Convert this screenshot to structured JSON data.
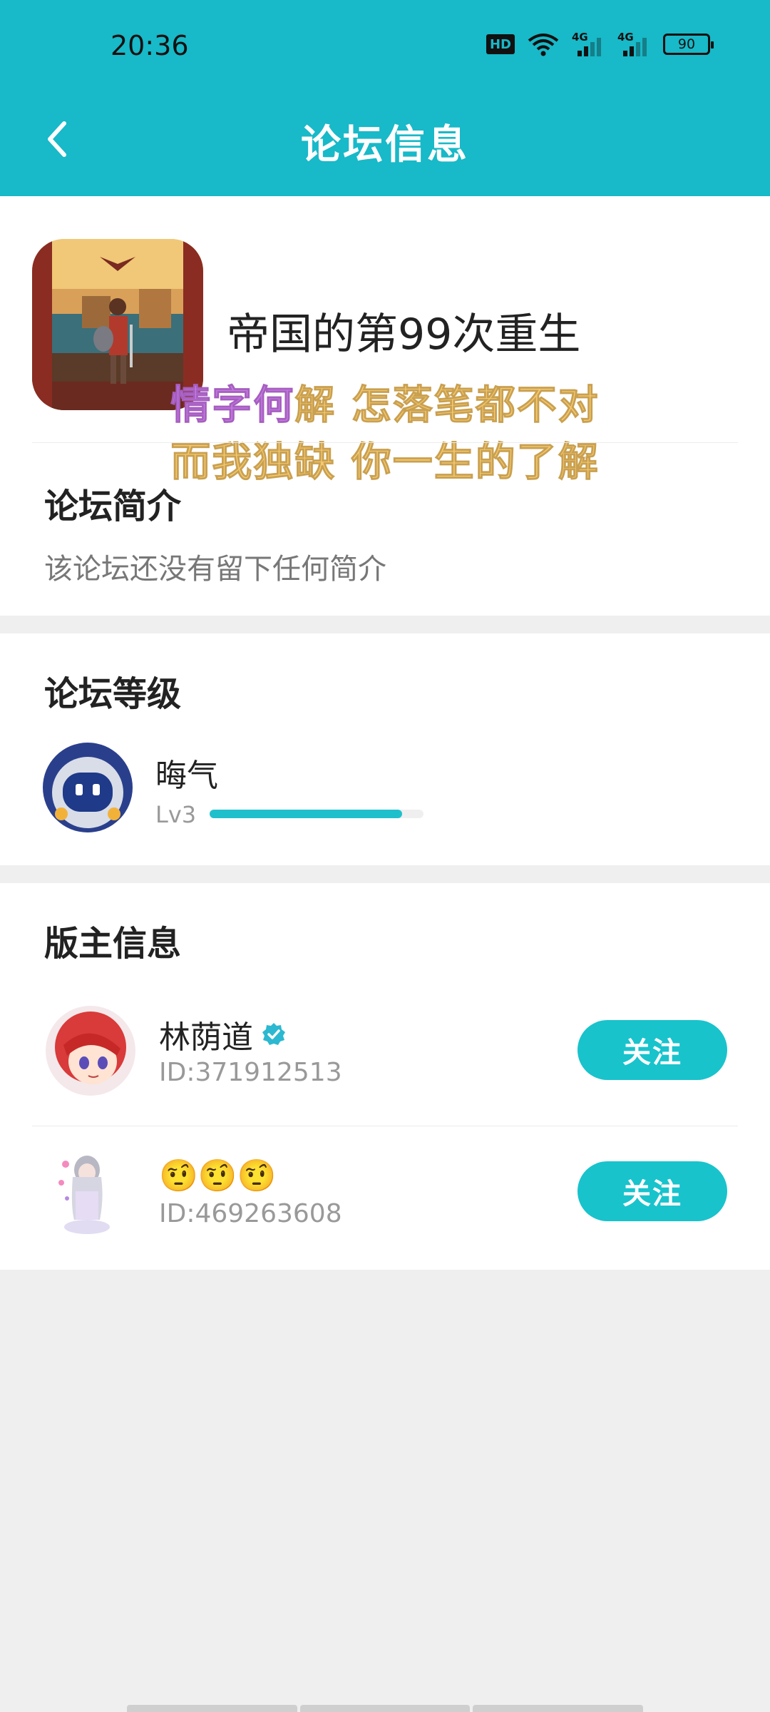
{
  "status_bar": {
    "time": "20:36",
    "hd_label": "HD",
    "signal_label_1": "4G",
    "signal_label_2": "4G",
    "battery": "90"
  },
  "nav": {
    "title": "论坛信息"
  },
  "forum": {
    "name": "帝国的第99次重生"
  },
  "overlay_lyrics": {
    "line1_purple": "情字何",
    "line1_rest": "解 怎落笔都不对",
    "line2": "而我独缺 你一生的了解"
  },
  "intro": {
    "title": "论坛简介",
    "text": "该论坛还没有留下任何简介"
  },
  "level": {
    "title": "论坛等级",
    "name": "晦气",
    "level_label": "Lv3",
    "progress": 0.9
  },
  "moderators": {
    "title": "版主信息",
    "list": [
      {
        "name": "林荫道",
        "id": "ID:371912513",
        "verified": true,
        "follow_label": "关注"
      },
      {
        "name": "🤨🤨🤨",
        "id": "ID:469263608",
        "verified": false,
        "follow_label": "关注"
      }
    ]
  },
  "colors": {
    "accent": "#18b9c8",
    "button": "#18c3cc"
  }
}
